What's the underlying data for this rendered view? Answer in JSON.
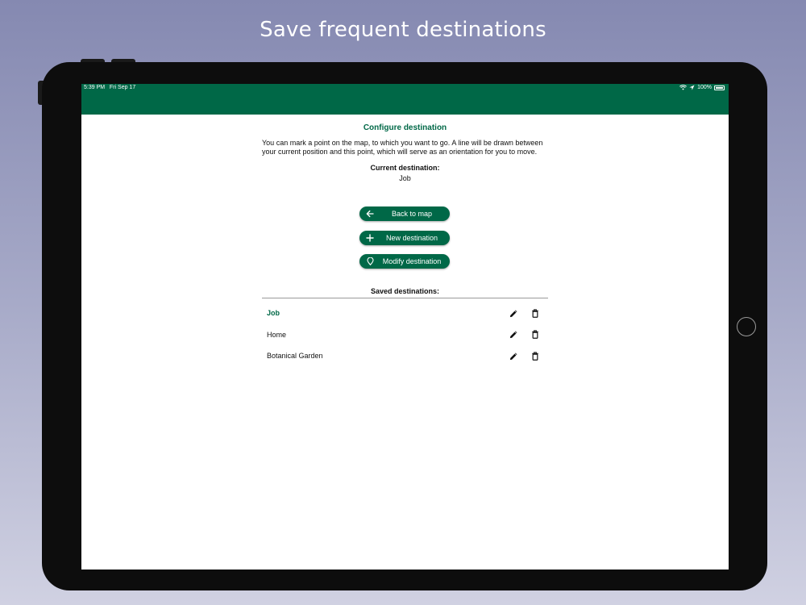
{
  "headline": "Save frequent destinations",
  "status_bar": {
    "time": "5:39 PM",
    "date": "Fri Sep 17",
    "battery": "100%",
    "color": "#006847"
  },
  "page": {
    "title": "Configure destination",
    "description": "You can mark a point on the map, to which you want to go. A line will be drawn between your current position and this point, which will serve as an orientation for you to move.",
    "current_label": "Current destination:",
    "current_value": "Job"
  },
  "buttons": {
    "back": {
      "label": "Back to map",
      "icon": "arrow-left-icon"
    },
    "new": {
      "label": "New destination",
      "icon": "plus-icon"
    },
    "modify": {
      "label": "Modify destination",
      "icon": "map-pin-icon"
    }
  },
  "saved": {
    "label": "Saved destinations:",
    "items": [
      {
        "name": "Job",
        "active": true
      },
      {
        "name": "Home",
        "active": false
      },
      {
        "name": "Botanical Garden",
        "active": false
      }
    ],
    "edit_icon": "pencil-icon",
    "delete_icon": "trash-icon"
  }
}
